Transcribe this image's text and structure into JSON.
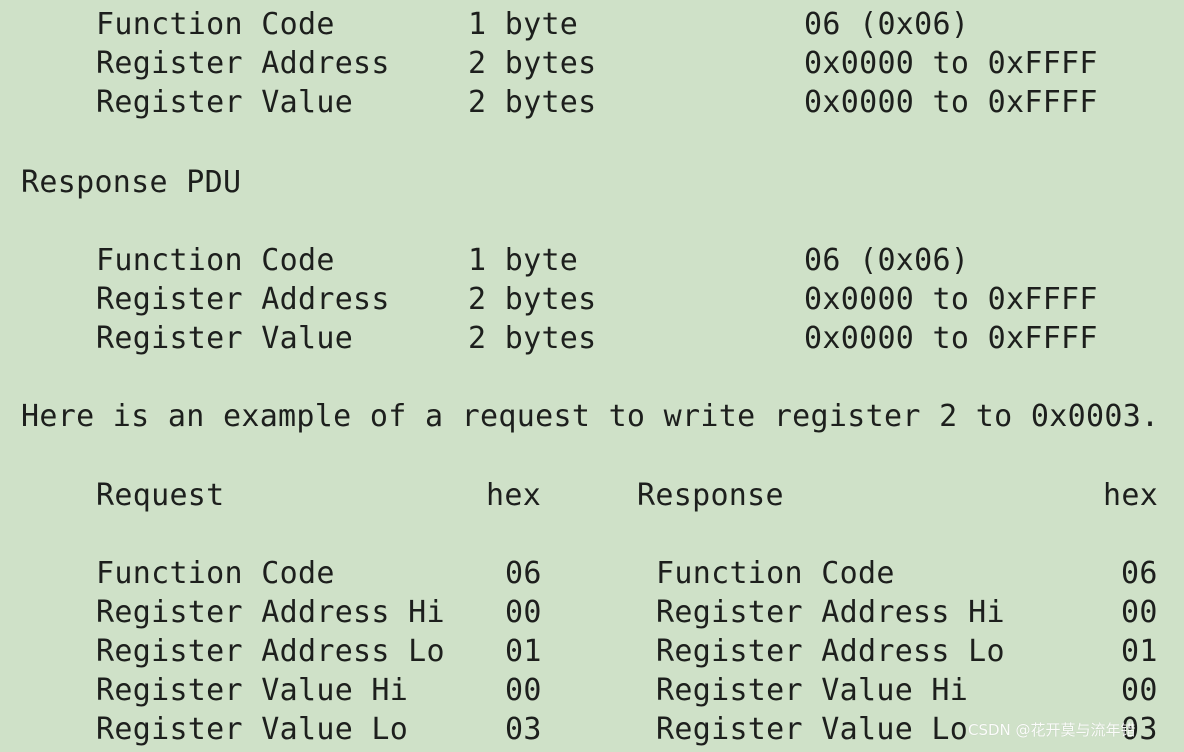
{
  "request_pdu": {
    "rows": [
      {
        "field": "Function Code",
        "size": "1 byte",
        "range": "06 (0x06)"
      },
      {
        "field": "Register Address",
        "size": "2 bytes",
        "range": "0x0000 to 0xFFFF"
      },
      {
        "field": "Register Value",
        "size": "2 bytes",
        "range": "0x0000 to 0xFFFF"
      }
    ]
  },
  "response_pdu": {
    "heading": "Response PDU",
    "rows": [
      {
        "field": "Function Code",
        "size": "1 byte",
        "range": "06 (0x06)"
      },
      {
        "field": "Register Address",
        "size": "2 bytes",
        "range": "0x0000 to 0xFFFF"
      },
      {
        "field": "Register Value",
        "size": "2 bytes",
        "range": "0x0000 to 0xFFFF"
      }
    ]
  },
  "example": {
    "sentence": "Here is an example of a request to write register 2 to 0x0003.",
    "request_header": "Request",
    "request_hex_header": "hex",
    "response_header": "Response",
    "response_hex_header": "hex",
    "request_rows": [
      {
        "field": "Function Code",
        "hex": "06"
      },
      {
        "field": "Register Address Hi",
        "hex": "00"
      },
      {
        "field": "Register Address Lo",
        "hex": "01"
      },
      {
        "field": "Register Value Hi",
        "hex": "00"
      },
      {
        "field": "Register Value Lo",
        "hex": "03"
      }
    ],
    "response_rows": [
      {
        "field": "Function Code",
        "hex": "06"
      },
      {
        "field": "Register Address Hi",
        "hex": "00"
      },
      {
        "field": "Register Address Lo",
        "hex": "01"
      },
      {
        "field": "Register Value Hi",
        "hex": "00"
      },
      {
        "field": "Register Value Lo",
        "hex": "03"
      }
    ]
  },
  "watermark": "CSDN @花开莫与流年错"
}
